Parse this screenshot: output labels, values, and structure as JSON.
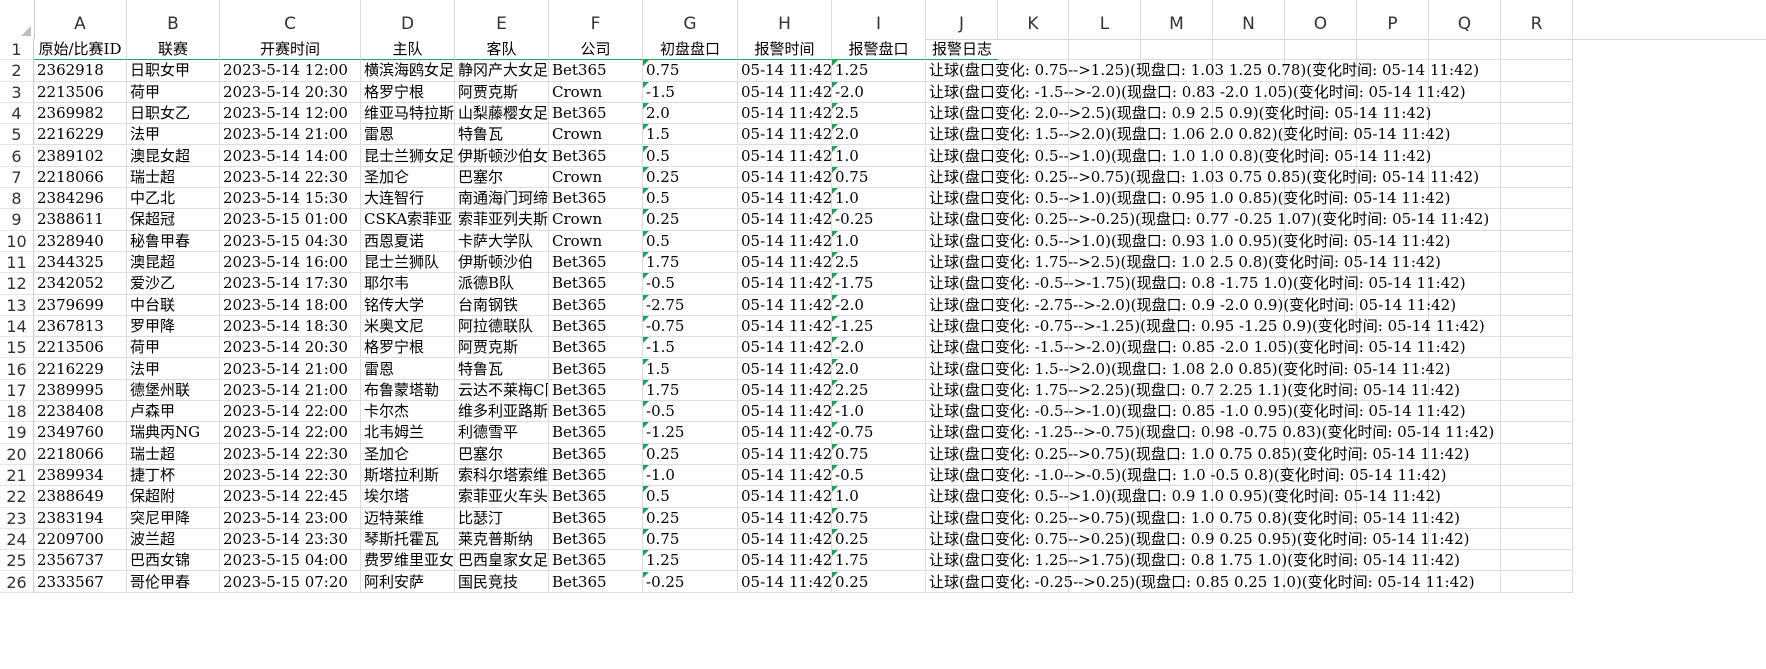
{
  "columns": [
    "A",
    "B",
    "C",
    "D",
    "E",
    "F",
    "G",
    "H",
    "I",
    "J",
    "K",
    "L",
    "M",
    "N",
    "O",
    "P",
    "Q",
    "R"
  ],
  "header_row": {
    "row_number": "1",
    "cells": [
      "原始/比赛ID",
      "联赛",
      "开赛时间",
      "主队",
      "客队",
      "公司",
      "初盘盘口",
      "报警时间",
      "报警盘口",
      "报警日志"
    ]
  },
  "rows": [
    {
      "n": "2",
      "id": "2362918",
      "league": "日职女甲",
      "time": "2023-5-14 12:00",
      "home": "横滨海鸥女足",
      "away": "静冈产大女足",
      "company": "Bet365",
      "init": "0.75",
      "alert_time": "05-14 11:42",
      "alert": "1.25",
      "log": "让球(盘口变化: 0.75-->1.25)(现盘口: 1.03  1.25  0.78)(变化时间: 05-14 11:42)"
    },
    {
      "n": "3",
      "id": "2213506",
      "league": "荷甲",
      "time": "2023-5-14 20:30",
      "home": "格罗宁根",
      "away": "阿贾克斯",
      "company": "Crown",
      "init": "-1.5",
      "alert_time": "05-14 11:42",
      "alert": "-2.0",
      "log": "让球(盘口变化: -1.5-->-2.0)(现盘口: 0.83  -2.0  1.05)(变化时间: 05-14 11:42)"
    },
    {
      "n": "4",
      "id": "2369982",
      "league": "日职女乙",
      "time": "2023-5-14 12:00",
      "home": "维亚马特拉斯",
      "away": "山梨藤樱女足",
      "company": "Bet365",
      "init": "2.0",
      "alert_time": "05-14 11:42",
      "alert": "2.5",
      "log": "让球(盘口变化: 2.0-->2.5)(现盘口: 0.9  2.5  0.9)(变化时间: 05-14 11:42)"
    },
    {
      "n": "5",
      "id": "2216229",
      "league": "法甲",
      "time": "2023-5-14 21:00",
      "home": "雷恩",
      "away": "特鲁瓦",
      "company": "Crown",
      "init": "1.5",
      "alert_time": "05-14 11:42",
      "alert": "2.0",
      "log": "让球(盘口变化: 1.5-->2.0)(现盘口: 1.06  2.0  0.82)(变化时间: 05-14 11:42)"
    },
    {
      "n": "6",
      "id": "2389102",
      "league": "澳昆女超",
      "time": "2023-5-14 14:00",
      "home": "昆士兰狮女足",
      "away": "伊斯顿沙伯女足",
      "company": "Bet365",
      "init": "0.5",
      "alert_time": "05-14 11:42",
      "alert": "1.0",
      "log": "让球(盘口变化: 0.5-->1.0)(现盘口: 1.0  1.0  0.8)(变化时间: 05-14 11:42)"
    },
    {
      "n": "7",
      "id": "2218066",
      "league": "瑞士超",
      "time": "2023-5-14 22:30",
      "home": "圣加仑",
      "away": "巴塞尔",
      "company": "Crown",
      "init": "0.25",
      "alert_time": "05-14 11:42",
      "alert": "0.75",
      "log": "让球(盘口变化: 0.25-->0.75)(现盘口: 1.03  0.75  0.85)(变化时间: 05-14 11:42)"
    },
    {
      "n": "8",
      "id": "2384296",
      "league": "中乙北",
      "time": "2023-5-14 15:30",
      "home": "大连智行",
      "away": "南通海门珂缔",
      "company": "Bet365",
      "init": "0.5",
      "alert_time": "05-14 11:42",
      "alert": "1.0",
      "log": "让球(盘口变化: 0.5-->1.0)(现盘口: 0.95  1.0  0.85)(变化时间: 05-14 11:42)"
    },
    {
      "n": "9",
      "id": "2388611",
      "league": "保超冠",
      "time": "2023-5-15 01:00",
      "home": "CSKA索菲亚",
      "away": "索菲亚列夫斯基",
      "company": "Crown",
      "init": "0.25",
      "alert_time": "05-14 11:42",
      "alert": "-0.25",
      "log": "让球(盘口变化: 0.25-->-0.25)(现盘口: 0.77  -0.25  1.07)(变化时间: 05-14 11:42)"
    },
    {
      "n": "10",
      "id": "2328940",
      "league": "秘鲁甲春",
      "time": "2023-5-15 04:30",
      "home": "西恩夏诺",
      "away": "卡萨大学队",
      "company": "Crown",
      "init": "0.5",
      "alert_time": "05-14 11:42",
      "alert": "1.0",
      "log": "让球(盘口变化: 0.5-->1.0)(现盘口: 0.93  1.0  0.95)(变化时间: 05-14 11:42)"
    },
    {
      "n": "11",
      "id": "2344325",
      "league": "澳昆超",
      "time": "2023-5-14 16:00",
      "home": "昆士兰狮队",
      "away": "伊斯顿沙伯",
      "company": "Bet365",
      "init": "1.75",
      "alert_time": "05-14 11:42",
      "alert": "2.5",
      "log": "让球(盘口变化: 1.75-->2.5)(现盘口: 1.0  2.5  0.8)(变化时间: 05-14 11:42)"
    },
    {
      "n": "12",
      "id": "2342052",
      "league": "爱沙乙",
      "time": "2023-5-14 17:30",
      "home": "耶尔韦",
      "away": "派德B队",
      "company": "Bet365",
      "init": "-0.5",
      "alert_time": "05-14 11:42",
      "alert": "-1.75",
      "log": "让球(盘口变化: -0.5-->-1.75)(现盘口: 0.8  -1.75  1.0)(变化时间: 05-14 11:42)"
    },
    {
      "n": "13",
      "id": "2379699",
      "league": "中台联",
      "time": "2023-5-14 18:00",
      "home": "铭传大学",
      "away": "台南钢铁",
      "company": "Bet365",
      "init": "-2.75",
      "alert_time": "05-14 11:42",
      "alert": "-2.0",
      "log": "让球(盘口变化: -2.75-->-2.0)(现盘口: 0.9  -2.0  0.9)(变化时间: 05-14 11:42)"
    },
    {
      "n": "14",
      "id": "2367813",
      "league": "罗甲降",
      "time": "2023-5-14 18:30",
      "home": "米奥文尼",
      "away": "阿拉德联队",
      "company": "Bet365",
      "init": "-0.75",
      "alert_time": "05-14 11:42",
      "alert": "-1.25",
      "log": "让球(盘口变化: -0.75-->-1.25)(现盘口: 0.95  -1.25  0.9)(变化时间: 05-14 11:42)"
    },
    {
      "n": "15",
      "id": "2213506",
      "league": "荷甲",
      "time": "2023-5-14 20:30",
      "home": "格罗宁根",
      "away": "阿贾克斯",
      "company": "Bet365",
      "init": "-1.5",
      "alert_time": "05-14 11:42",
      "alert": "-2.0",
      "log": "让球(盘口变化: -1.5-->-2.0)(现盘口: 0.85  -2.0  1.05)(变化时间: 05-14 11:42)"
    },
    {
      "n": "16",
      "id": "2216229",
      "league": "法甲",
      "time": "2023-5-14 21:00",
      "home": "雷恩",
      "away": "特鲁瓦",
      "company": "Bet365",
      "init": "1.5",
      "alert_time": "05-14 11:42",
      "alert": "2.0",
      "log": "让球(盘口变化: 1.5-->2.0)(现盘口: 1.08  2.0  0.85)(变化时间: 05-14 11:42)"
    },
    {
      "n": "17",
      "id": "2389995",
      "league": "德堡州联",
      "time": "2023-5-14 21:00",
      "home": "布鲁蒙塔勒",
      "away": "云达不莱梅C队",
      "company": "Bet365",
      "init": "1.75",
      "alert_time": "05-14 11:42",
      "alert": "2.25",
      "log": "让球(盘口变化: 1.75-->2.25)(现盘口: 0.7  2.25  1.1)(变化时间: 05-14 11:42)"
    },
    {
      "n": "18",
      "id": "2238408",
      "league": "卢森甲",
      "time": "2023-5-14 22:00",
      "home": "卡尔杰",
      "away": "维多利亚路斯",
      "company": "Bet365",
      "init": "-0.5",
      "alert_time": "05-14 11:42",
      "alert": "-1.0",
      "log": "让球(盘口变化: -0.5-->-1.0)(现盘口: 0.85  -1.0  0.95)(变化时间: 05-14 11:42)"
    },
    {
      "n": "19",
      "id": "2349760",
      "league": "瑞典丙NG",
      "time": "2023-5-14 22:00",
      "home": "北韦姆兰",
      "away": "利德雪平",
      "company": "Bet365",
      "init": "-1.25",
      "alert_time": "05-14 11:42",
      "alert": "-0.75",
      "log": "让球(盘口变化: -1.25-->-0.75)(现盘口: 0.98  -0.75  0.83)(变化时间: 05-14 11:42)"
    },
    {
      "n": "20",
      "id": "2218066",
      "league": "瑞士超",
      "time": "2023-5-14 22:30",
      "home": "圣加仑",
      "away": "巴塞尔",
      "company": "Bet365",
      "init": "0.25",
      "alert_time": "05-14 11:42",
      "alert": "0.75",
      "log": "让球(盘口变化: 0.25-->0.75)(现盘口: 1.0  0.75  0.85)(变化时间: 05-14 11:42)"
    },
    {
      "n": "21",
      "id": "2389934",
      "league": "捷丁杯",
      "time": "2023-5-14 22:30",
      "home": "斯塔拉利斯",
      "away": "索科尔塔索维",
      "company": "Bet365",
      "init": "-1.0",
      "alert_time": "05-14 11:42",
      "alert": "-0.5",
      "log": "让球(盘口变化: -1.0-->-0.5)(现盘口: 1.0  -0.5  0.8)(变化时间: 05-14 11:42)"
    },
    {
      "n": "22",
      "id": "2388649",
      "league": "保超附",
      "time": "2023-5-14 22:45",
      "home": "埃尔塔",
      "away": "索菲亚火车头",
      "company": "Bet365",
      "init": "0.5",
      "alert_time": "05-14 11:42",
      "alert": "1.0",
      "log": "让球(盘口变化: 0.5-->1.0)(现盘口: 0.9  1.0  0.95)(变化时间: 05-14 11:42)"
    },
    {
      "n": "23",
      "id": "2383194",
      "league": "突尼甲降",
      "time": "2023-5-14 23:00",
      "home": "迈特莱维",
      "away": "比瑟汀",
      "company": "Bet365",
      "init": "0.25",
      "alert_time": "05-14 11:42",
      "alert": "0.75",
      "log": "让球(盘口变化: 0.25-->0.75)(现盘口: 1.0  0.75  0.8)(变化时间: 05-14 11:42)"
    },
    {
      "n": "24",
      "id": "2209700",
      "league": "波兰超",
      "time": "2023-5-14 23:30",
      "home": "琴斯托霍瓦",
      "away": "莱克普斯纳",
      "company": "Bet365",
      "init": "0.75",
      "alert_time": "05-14 11:42",
      "alert": "0.25",
      "log": "让球(盘口变化: 0.75-->0.25)(现盘口: 0.9  0.25  0.95)(变化时间: 05-14 11:42)"
    },
    {
      "n": "25",
      "id": "2356737",
      "league": "巴西女锦",
      "time": "2023-5-15 04:00",
      "home": "费罗维里亚女足",
      "away": "巴西皇家女足",
      "company": "Bet365",
      "init": "1.25",
      "alert_time": "05-14 11:42",
      "alert": "1.75",
      "log": "让球(盘口变化: 1.25-->1.75)(现盘口: 0.8  1.75  1.0)(变化时间: 05-14 11:42)"
    },
    {
      "n": "26",
      "id": "2333567",
      "league": "哥伦甲春",
      "time": "2023-5-15 07:20",
      "home": "阿利安萨",
      "away": "国民竞技",
      "company": "Bet365",
      "init": "-0.25",
      "alert_time": "05-14 11:42",
      "alert": "0.25",
      "log": "让球(盘口变化: -0.25-->0.25)(现盘口: 0.85  0.25  1.0)(变化时间: 05-14 11:42)"
    }
  ]
}
